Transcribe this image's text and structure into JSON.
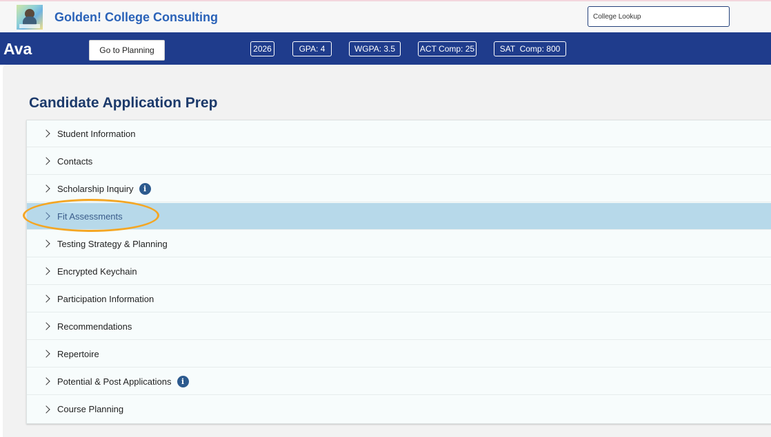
{
  "header": {
    "title": "Golden! College Consulting",
    "logo_icon": "profile-photo-logo",
    "lookup_placeholder": "College Lookup"
  },
  "student_bar": {
    "name": "Ava",
    "go_button": "Go to Planning",
    "badges": [
      "2026",
      "GPA: 4",
      "WGPA: 3.5",
      "ACT Comp: 25",
      "SAT  Comp: 800"
    ]
  },
  "section": {
    "title": "Candidate Application Prep",
    "items": [
      {
        "label": "Student Information"
      },
      {
        "label": "Contacts"
      },
      {
        "label": "Scholarship Inquiry",
        "info": true
      },
      {
        "label": "Fit Assessments",
        "selected": true
      },
      {
        "label": "Testing Strategy & Planning"
      },
      {
        "label": "Encrypted Keychain"
      },
      {
        "label": "Participation Information"
      },
      {
        "label": "Recommendations"
      },
      {
        "label": "Repertoire"
      },
      {
        "label": "Potential & Post Applications",
        "info": true
      },
      {
        "label": "Course Planning"
      }
    ]
  },
  "colors": {
    "brand_blue": "#2a62b8",
    "nav_bar": "#1f3c8c",
    "selected_row": "#b7d9ea",
    "highlight": "#f4a623"
  }
}
